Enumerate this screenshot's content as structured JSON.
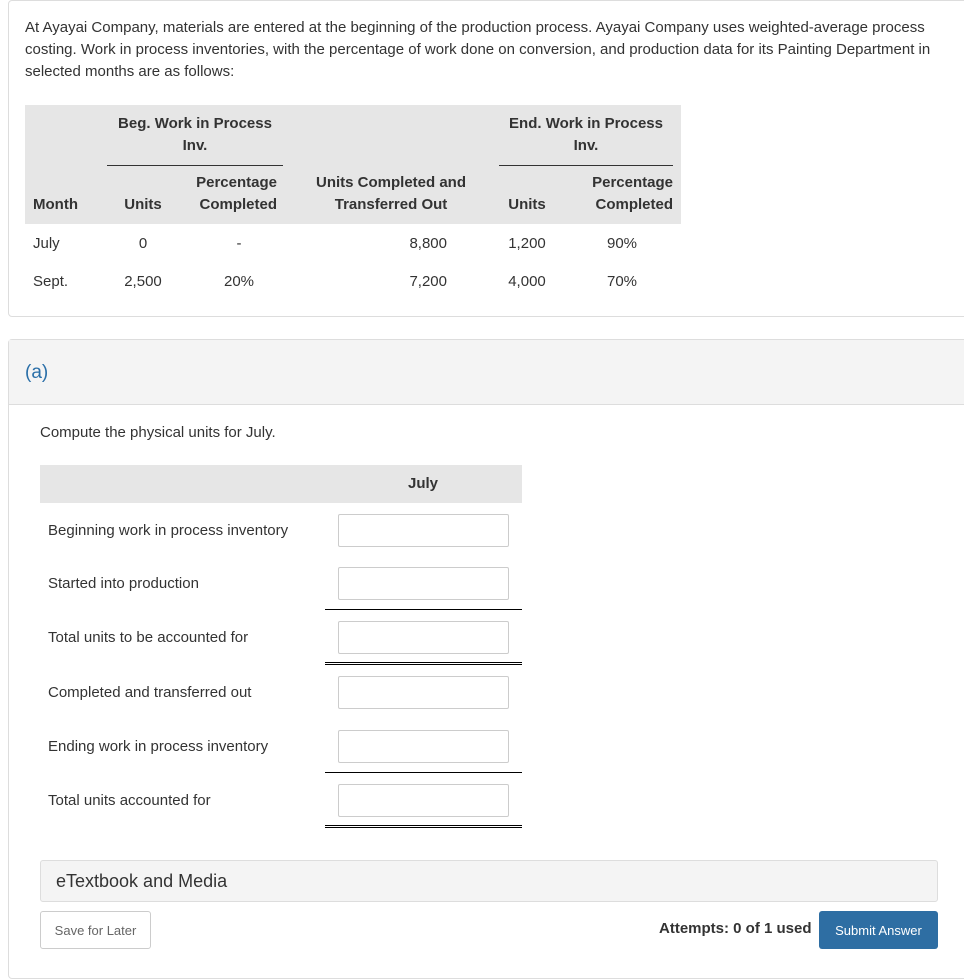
{
  "intro_text": "At Ayayai Company, materials are entered at the beginning of the production process. Ayayai Company uses weighted-average process costing. Work in process inventories, with the percentage of work done on conversion, and production data for its Painting Department in selected months are as follows:",
  "data_table": {
    "group_headers": {
      "beginning": "Beg. Work in Process Inv.",
      "ending": "End. Work in Process Inv."
    },
    "columns": [
      "Month",
      "Units",
      "Percentage Completed",
      "Units Completed and Transferred Out",
      "Units",
      "Percentage Completed"
    ],
    "rows": [
      {
        "month": "July",
        "beg_units": "0",
        "beg_pct": "-",
        "transferred": "8,800",
        "end_units": "1,200",
        "end_pct": "90%"
      },
      {
        "month": "Sept.",
        "beg_units": "2,500",
        "beg_pct": "20%",
        "transferred": "7,200",
        "end_units": "4,000",
        "end_pct": "70%"
      }
    ]
  },
  "part": {
    "label": "(a)",
    "prompt": "Compute the physical units for July.",
    "column_header": "July",
    "rows": [
      {
        "label": "Beginning work in process inventory",
        "value": ""
      },
      {
        "label": "Started into production",
        "value": ""
      },
      {
        "label": "Total units to be accounted for",
        "value": ""
      },
      {
        "label": "Completed and transferred out",
        "value": ""
      },
      {
        "label": "Ending work in process inventory",
        "value": ""
      },
      {
        "label": "Total units accounted for",
        "value": ""
      }
    ]
  },
  "footer": {
    "media_label": "eTextbook and Media",
    "save_label": "Save for Later",
    "attempts": "Attempts: 0 of 1 used",
    "submit_label": "Submit Answer"
  },
  "colors": {
    "accent": "#2e6ea3",
    "part_label": "#2a6fa8"
  }
}
